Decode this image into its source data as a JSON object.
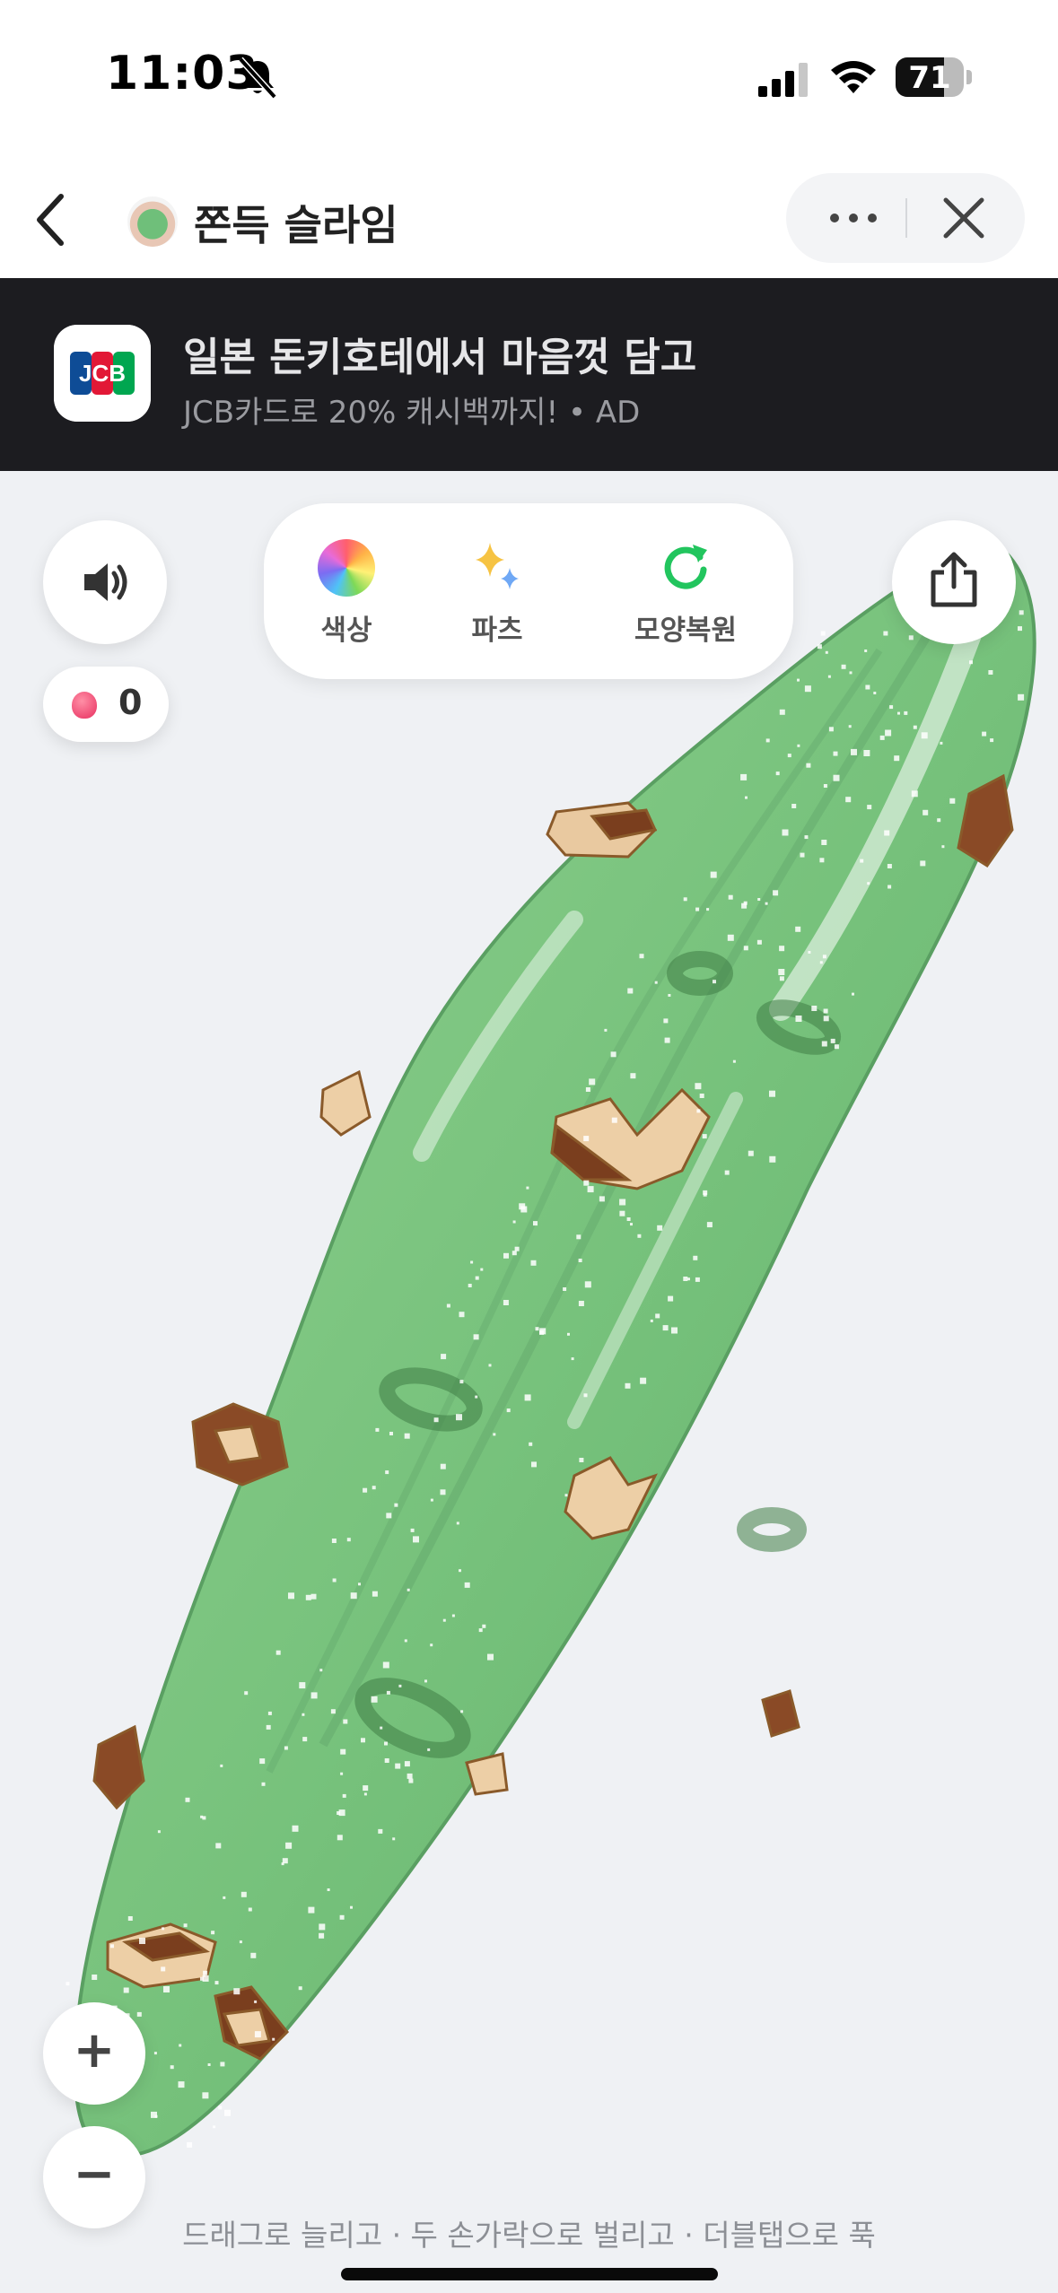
{
  "status_bar": {
    "time": "11:03",
    "battery": "71",
    "battery_level_percent": 71,
    "icons": [
      "bell-slash-icon",
      "cellular-signal-icon",
      "wifi-icon",
      "battery-icon"
    ]
  },
  "nav": {
    "title": "쫀득 슬라임",
    "back_icon": "chevron-left-icon",
    "more_icon": "more-horizontal-icon",
    "close_icon": "close-icon"
  },
  "ad": {
    "title": "일본 돈키호테에서 마음껏 담고",
    "subtitle": "JCB카드로 20% 캐시백까지! • AD",
    "logo_text": "JCB"
  },
  "controls": {
    "sound_icon": "speaker-icon",
    "counter_value": "0",
    "share_icon": "share-icon",
    "zoom_in": "+",
    "zoom_out": "−"
  },
  "tools": [
    {
      "label": "색상",
      "icon": "color-wheel-icon"
    },
    {
      "label": "파츠",
      "icon": "sparkle-icon"
    },
    {
      "label": "모양복원",
      "icon": "refresh-icon"
    }
  ],
  "hint": "드래그로 늘리고 · 두 손가락으로 벌리고 · 더블탭으로 푹",
  "colors": {
    "slime": "#7cc57f",
    "slime_dark": "#4f9e5a",
    "accent_reset": "#22c55e",
    "ad_background": "#1c1c20",
    "counter_dot": "#e83060"
  }
}
